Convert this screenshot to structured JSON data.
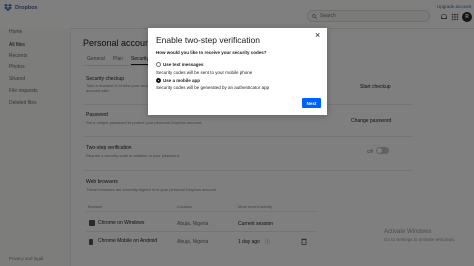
{
  "app": {
    "brand": "Dropbox",
    "search_placeholder": "Search",
    "top_link": "Upgrade account",
    "avatar_initial": "R"
  },
  "sidebar": {
    "items": [
      {
        "label": "Home"
      },
      {
        "label": "All files"
      },
      {
        "label": "Recents"
      },
      {
        "label": "Photos"
      },
      {
        "label": "Shared"
      },
      {
        "label": "File requests"
      },
      {
        "label": "Deleted files"
      }
    ],
    "privacy_label": "Privacy and legal"
  },
  "main": {
    "title": "Personal account",
    "tabs": [
      {
        "label": "General"
      },
      {
        "label": "Plan"
      },
      {
        "label": "Security"
      }
    ],
    "security_checkup": {
      "label": "Security checkup",
      "desc": "Take a moment to review your security settings and keep your account safe.",
      "action": "Start checkup"
    },
    "password": {
      "label": "Password",
      "desc": "Set a unique password to protect your personal Dropbox account.",
      "action": "Change password"
    },
    "two_step": {
      "label": "Two-step verification",
      "desc": "Require a security code in addition to your password.",
      "state_label": "Off"
    },
    "web_browsers": {
      "label": "Web browsers",
      "desc": "These browsers are currently signed in to your personal Dropbox account.",
      "columns": [
        "Browser",
        "Location",
        "Most recent activity"
      ],
      "rows": [
        {
          "browser": "Chrome on Windows",
          "location": "Abuja, Nigeria",
          "activity": "Current session"
        },
        {
          "browser": "Chrome Mobile on Android",
          "location": "Abuja, Nigeria",
          "activity": "1 day ago"
        }
      ]
    }
  },
  "watermark": {
    "title": "Activate Windows",
    "subtitle": "Go to Settings to activate Windows."
  },
  "modal": {
    "title": "Enable two-step verification",
    "question": "How would you like to receive your security codes?",
    "options": [
      {
        "label": "Use text messages",
        "desc": "Security codes will be sent to your mobile phone",
        "selected": false
      },
      {
        "label": "Use a mobile app",
        "desc": "Security codes will be generated by an authenticator app",
        "selected": true
      }
    ],
    "next_label": "Next"
  }
}
